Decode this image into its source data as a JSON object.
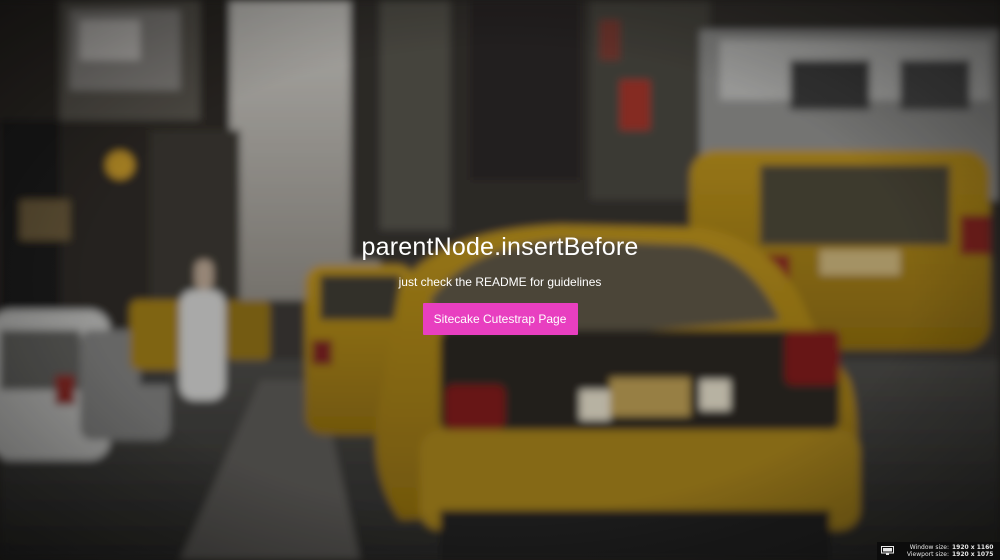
{
  "hero": {
    "title": "parentNode.insertBefore",
    "subtitle": "just check the README for guidelines",
    "cta_label": "Sitecake Cutestrap Page",
    "cta_color": "#e83fc0",
    "background": "blurred street photo with yellow taxis"
  },
  "size_widget": {
    "icon": "monitor-icon",
    "window_label": "Window size:",
    "window_value": "1920 x 1160",
    "viewport_label": "Viewport size:",
    "viewport_value": "1920 x 1075"
  }
}
